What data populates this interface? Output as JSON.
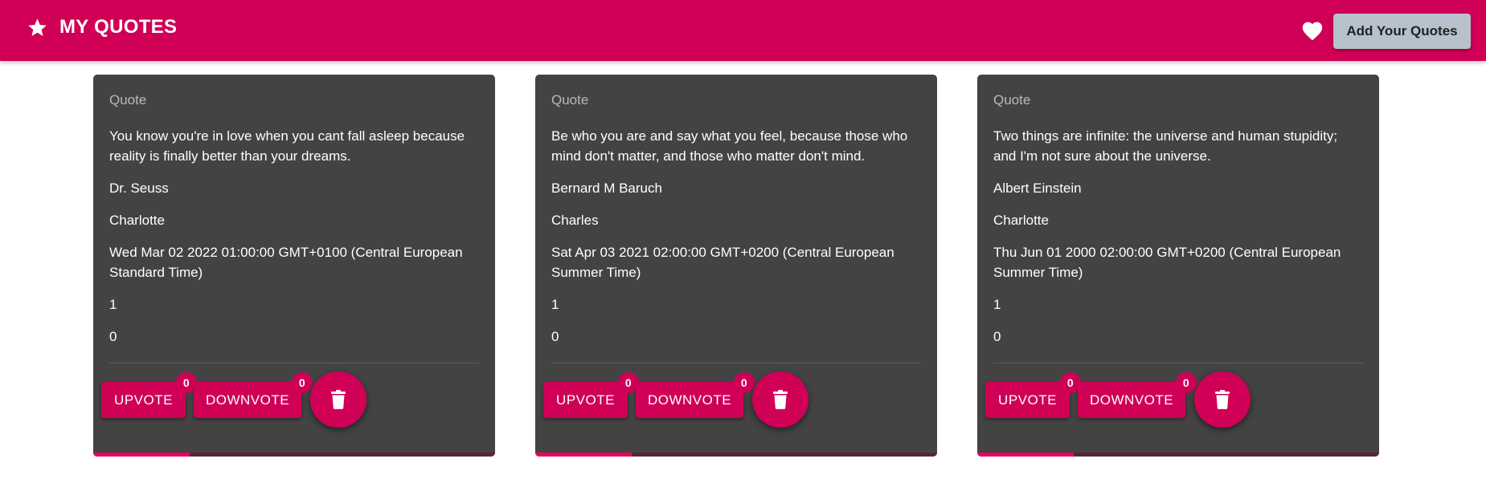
{
  "header": {
    "title": "MY QUOTES",
    "add_button_label": "Add Your Quotes"
  },
  "colors": {
    "primary": "#cf0056",
    "card_bg": "#434343",
    "add_button_bg": "#b6c1cb"
  },
  "icons": {
    "brand": "star-icon",
    "favorites": "heart-icon",
    "delete": "trash-icon"
  },
  "cards": [
    {
      "label": "Quote",
      "text": "You know you're in love when you cant fall asleep because reality is finally better than your dreams.",
      "author": "Dr. Seuss",
      "submitter": "Charlotte",
      "date": "Wed Mar 02 2022 01:00:00 GMT+0100 (Central European Standard Time)",
      "count_1": "1",
      "count_2": "0",
      "upvote_label": "UPVOTE",
      "upvote_count": "0",
      "downvote_label": "DOWNVOTE",
      "downvote_count": "0",
      "progress": 0.24
    },
    {
      "label": "Quote",
      "text": "Be who you are and say what you feel, because those who mind don't matter, and those who matter don't mind.",
      "author": "Bernard M Baruch",
      "submitter": "Charles",
      "date": "Sat Apr 03 2021 02:00:00 GMT+0200 (Central European Summer Time)",
      "count_1": "1",
      "count_2": "0",
      "upvote_label": "UPVOTE",
      "upvote_count": "0",
      "downvote_label": "DOWNVOTE",
      "downvote_count": "0",
      "progress": 0.24
    },
    {
      "label": "Quote",
      "text": "Two things are infinite: the universe and human stupidity; and I'm not sure about the universe.",
      "author": "Albert Einstein",
      "submitter": "Charlotte",
      "date": "Thu Jun 01 2000 02:00:00 GMT+0200 (Central European Summer Time)",
      "count_1": "1",
      "count_2": "0",
      "upvote_label": "UPVOTE",
      "upvote_count": "0",
      "downvote_label": "DOWNVOTE",
      "downvote_count": "0",
      "progress": 0.24
    }
  ]
}
